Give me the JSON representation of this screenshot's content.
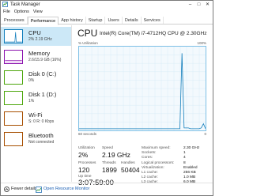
{
  "window": {
    "title": "Task Manager",
    "controls": [
      "–",
      "□",
      "✕"
    ]
  },
  "menu": [
    "File",
    "Options",
    "View"
  ],
  "tabs": [
    "Processes",
    "Performance",
    "App history",
    "Startup",
    "Users",
    "Details",
    "Services"
  ],
  "active_tab": "Performance",
  "sidebar": [
    {
      "name": "CPU",
      "value": "2% 2.19 GHz",
      "color": "#117dbb",
      "active": true
    },
    {
      "name": "Memory",
      "value": "2.6/15.9 GB (16%)",
      "color": "#8b12ae",
      "active": false
    },
    {
      "name": "Disk 0 (C:)",
      "value": "0%",
      "color": "#4da60c",
      "active": false
    },
    {
      "name": "Disk 1 (D:)",
      "value": "1%",
      "color": "#4da60c",
      "active": false
    },
    {
      "name": "Wi-Fi",
      "value": "S: 0 R: 0 Kbps",
      "color": "#a74f01",
      "active": false
    },
    {
      "name": "Bluetooth",
      "value": "Not connected",
      "color": "#a74f01",
      "active": false
    }
  ],
  "main": {
    "title": "CPU",
    "model": "Intel(R) Core(TM) i7-4712HQ CPU @ 2.30GHz",
    "graph_label_left": "% Utilization",
    "graph_label_right": "100%",
    "axis_left": "60 seconds",
    "axis_right": "0",
    "utilization_series": [
      2,
      2,
      2,
      2,
      2,
      2,
      2,
      2,
      2,
      2,
      2,
      2,
      2,
      2,
      2,
      2,
      2,
      2,
      2,
      2,
      2,
      2,
      2,
      2,
      2,
      2,
      2,
      2,
      2,
      2,
      2,
      2,
      2,
      2,
      2,
      2,
      2,
      2,
      2,
      2,
      2,
      2,
      2,
      2,
      2,
      2,
      2,
      2,
      92,
      3,
      3,
      3,
      2,
      2,
      2,
      2,
      2,
      3,
      8,
      2
    ],
    "stats": {
      "utilization_label": "Utilization",
      "utilization": "2%",
      "speed_label": "Speed",
      "speed": "2.19 GHz",
      "processes_label": "Processes",
      "processes": "120",
      "threads_label": "Threads",
      "threads": "1899",
      "handles_label": "Handles",
      "handles": "50404",
      "uptime_label": "Up time",
      "uptime": "3:07:59:00"
    },
    "specs": [
      {
        "k": "Maximum speed:",
        "v": "2.30 GHz"
      },
      {
        "k": "Sockets:",
        "v": "1"
      },
      {
        "k": "Cores:",
        "v": "4"
      },
      {
        "k": "Logical processors:",
        "v": "8"
      },
      {
        "k": "Virtualization:",
        "v": "Enabled"
      },
      {
        "k": "L1 cache:",
        "v": "256 KB"
      },
      {
        "k": "L2 cache:",
        "v": "1.0 MB"
      },
      {
        "k": "L3 cache:",
        "v": "6.0 MB"
      }
    ]
  },
  "footer": {
    "fewer_details": "Fewer details",
    "resource_monitor": "Open Resource Monitor"
  }
}
